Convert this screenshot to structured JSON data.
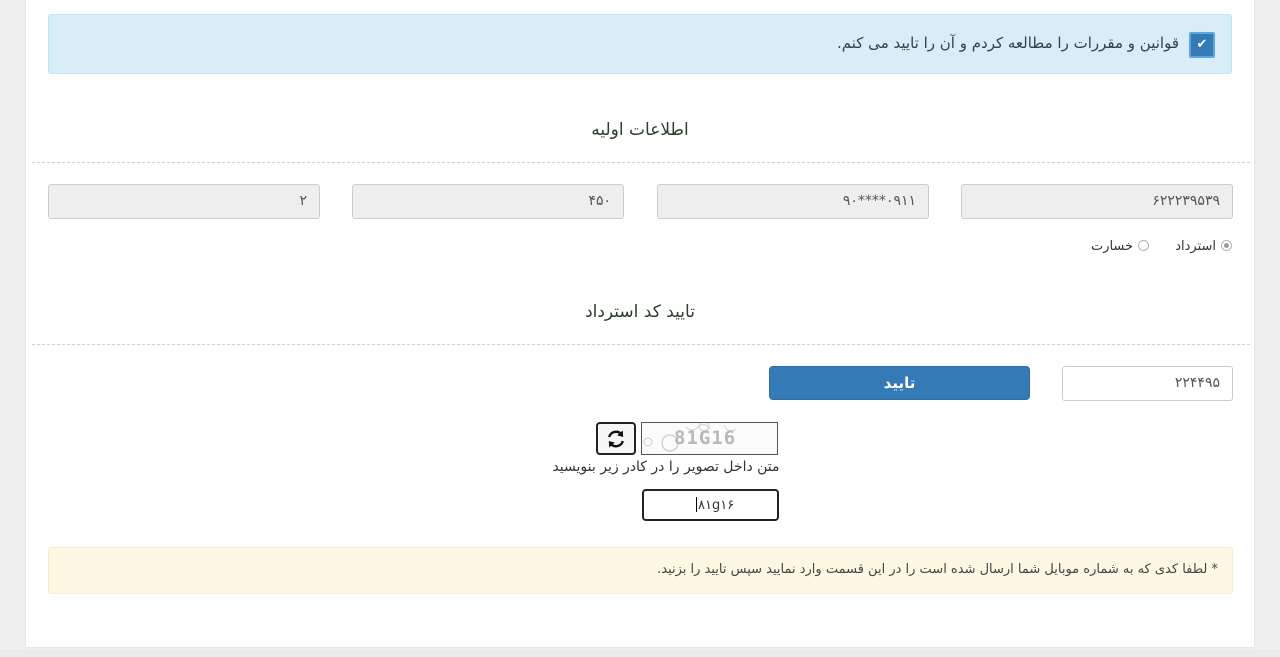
{
  "terms": {
    "checked": true,
    "checkmark": "✔",
    "label": "قوانین و مقررات را مطالعه کردم و آن را تایید می کنم."
  },
  "basic_info": {
    "title": "اطلاعات اولیه",
    "fields": [
      "۶۲۲۲۳۹۵۳۹",
      "۰۹۱۱****۹۰",
      "۴۵۰",
      "۲"
    ],
    "radio_options": [
      {
        "label": "استرداد",
        "selected": true
      },
      {
        "label": "خسارت",
        "selected": false
      }
    ]
  },
  "verify": {
    "title": "تایید کد استرداد",
    "code_value": "۲۲۴۴۹۵",
    "confirm_label": "تایید",
    "captcha_image_text": "81G16",
    "captcha_instruction": "متن داخل تصویر را در کادر زیر بنویسید",
    "captcha_value": "۸۱g۱۶",
    "refresh_icon": "refresh-icon"
  },
  "notice": {
    "text": "* لطفا کدی که به شماره موبایل شما ارسال شده است را در این قسمت وارد نمایید سپس تایید را بزنید."
  },
  "colors": {
    "primary": "#337ab7",
    "info_bg": "#d9edf7",
    "warning_bg": "#fcf8e3"
  }
}
